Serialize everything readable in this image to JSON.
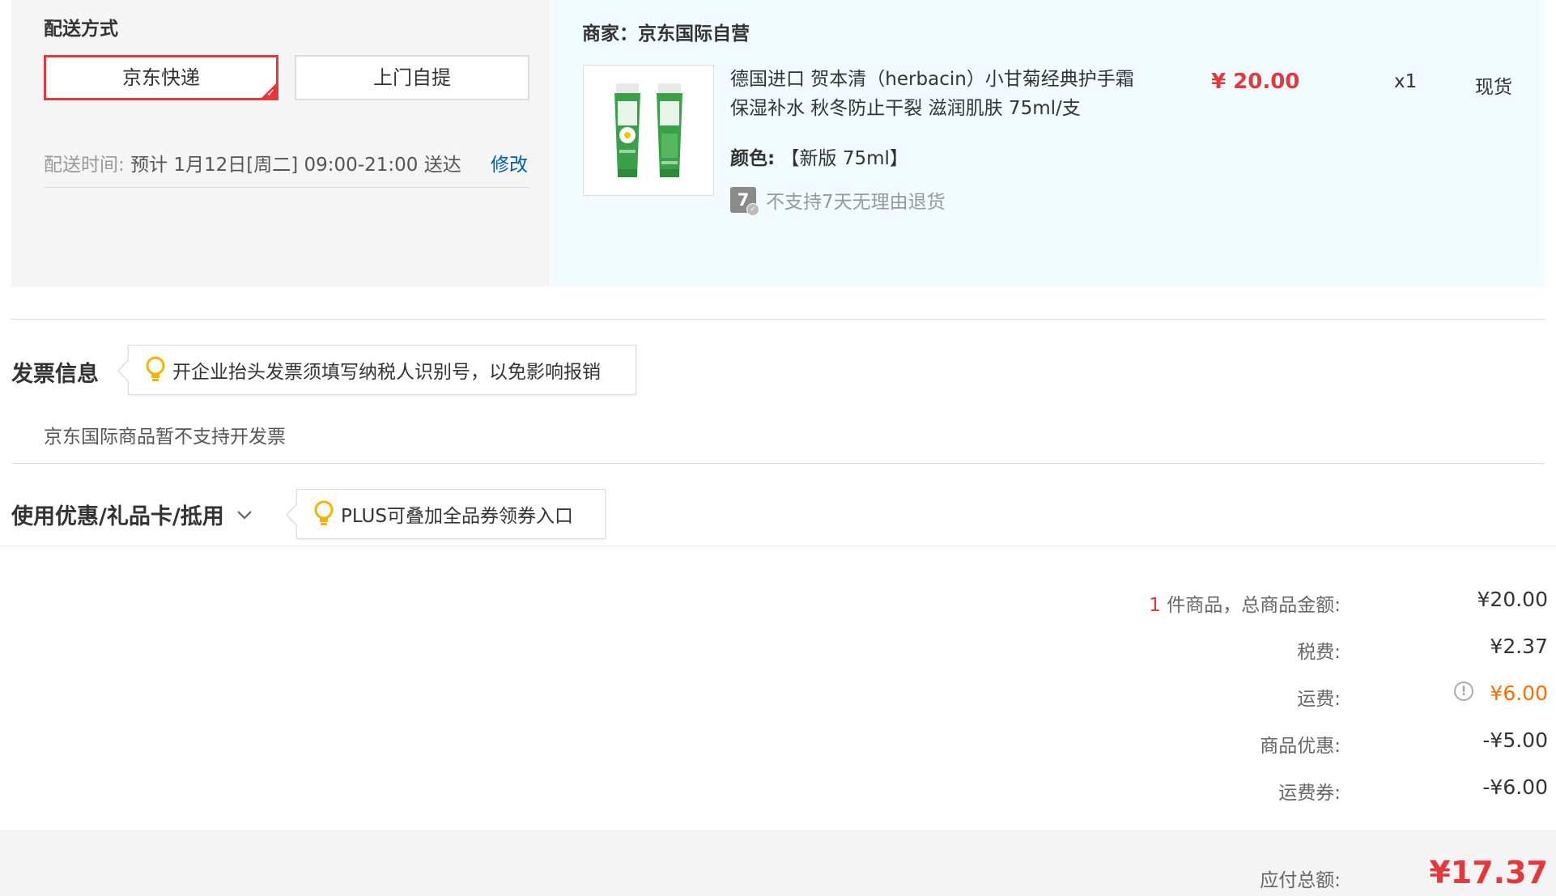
{
  "shipping": {
    "title": "配送方式",
    "options": [
      "京东快递",
      "上门自提"
    ],
    "time_label": "配送时间:",
    "time_value": "预计 1月12日[周二] 09:00-21:00 送达",
    "modify_label": "修改"
  },
  "product": {
    "merchant": "商家：京东国际自营",
    "name": "德国进口 贺本清（herbacin）小甘菊经典护手霜 保湿补水 秋冬防止干裂 滋润肌肤 75ml/支",
    "color_label": "颜色:",
    "color_value": "【新版 75ml】",
    "return_icon_text": "7",
    "return_policy": "不支持7天无理由退货",
    "price": "¥ 20.00",
    "quantity": "x1",
    "stock": "现货"
  },
  "invoice": {
    "title": "发票信息",
    "tip": "开企业抬头发票须填写纳税人识别号，以免影响报销",
    "note": "京东国际商品暂不支持开发票"
  },
  "coupon": {
    "title": "使用优惠/礼品卡/抵用",
    "tip": "PLUS可叠加全品券领券入口"
  },
  "summary": {
    "count": "1",
    "count_suffix": " 件商品，总商品金额:",
    "goods_total": "¥20.00",
    "tax_label": "税费:",
    "tax_value": "¥2.37",
    "shipping_label": "运费:",
    "shipping_value": "¥6.00",
    "discount_label": "商品优惠:",
    "discount_value": "-¥5.00",
    "ship_coupon_label": "运费券:",
    "ship_coupon_value": "-¥6.00",
    "total_label": "应付总额:",
    "total_value": "¥17.37"
  },
  "colors": {
    "accent_red": "#e4393c",
    "link_blue": "#005ea7",
    "shipping_orange": "#ff6c00",
    "tip_yellow": "#f5b400"
  },
  "icons": [
    "check-icon",
    "seven-day-return-icon",
    "lightbulb-icon",
    "chevron-down-icon",
    "warning-icon"
  ]
}
